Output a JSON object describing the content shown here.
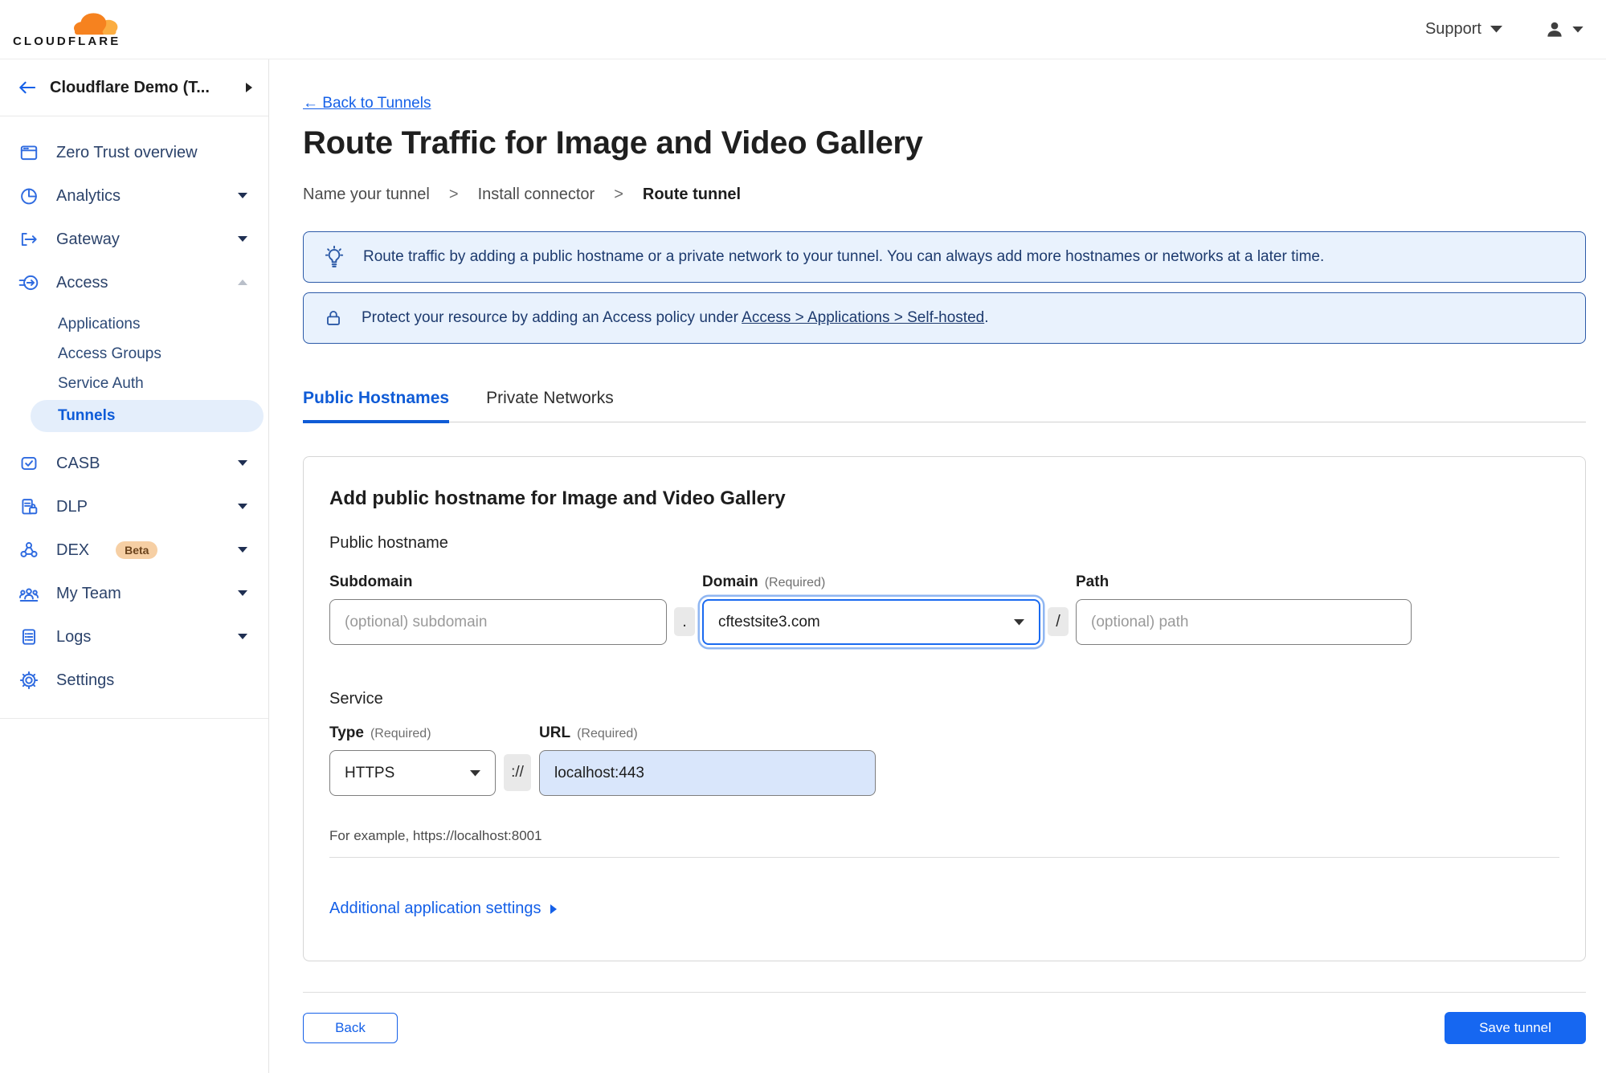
{
  "header": {
    "logo_text": "CLOUDFLARE",
    "support_label": "Support"
  },
  "sidebar": {
    "account": {
      "label": "Cloudflare Demo (T..."
    },
    "items": [
      {
        "label": "Zero Trust overview"
      },
      {
        "label": "Analytics"
      },
      {
        "label": "Gateway"
      },
      {
        "label": "Access"
      },
      {
        "label": "Applications"
      },
      {
        "label": "Access Groups"
      },
      {
        "label": "Service Auth"
      },
      {
        "label": "Tunnels"
      },
      {
        "label": "CASB"
      },
      {
        "label": "DLP"
      },
      {
        "label": "DEX",
        "badge": "Beta"
      },
      {
        "label": "My Team"
      },
      {
        "label": "Logs"
      },
      {
        "label": "Settings"
      }
    ]
  },
  "main": {
    "back_link": "← Back to Tunnels",
    "title": "Route Traffic for Image and Video Gallery",
    "steps": [
      "Name your tunnel",
      "Install connector",
      "Route tunnel"
    ],
    "steps_separator": ">",
    "banners": [
      {
        "text": "Route traffic by adding a public hostname or a private network to your tunnel. You can always add more hostnames or networks at a later time."
      },
      {
        "text_prefix": "Protect your resource by adding an Access policy under ",
        "link_text": "Access > Applications > Self-hosted",
        "text_suffix": "."
      }
    ],
    "tabs": [
      {
        "label": "Public Hostnames"
      },
      {
        "label": "Private Networks"
      }
    ],
    "form": {
      "heading": "Add public hostname for Image and Video Gallery",
      "public_hostname_label": "Public hostname",
      "subdomain_label": "Subdomain",
      "domain_label": "Domain",
      "path_label": "Path",
      "required_hint": "(Required)",
      "subdomain_placeholder": "(optional) subdomain",
      "domain_value": "cftestsite3.com",
      "path_placeholder": "(optional) path",
      "separators": {
        "dot": ".",
        "slash": "/",
        "scheme": "://"
      },
      "service_label": "Service",
      "type_label": "Type",
      "url_label": "URL",
      "type_value": "HTTPS",
      "url_value": "localhost:443",
      "example_text": "For example, https://localhost:8001",
      "additional_settings_label": "Additional application settings"
    },
    "footer": {
      "back_label": "Back",
      "save_label": "Save tunnel"
    }
  },
  "colors": {
    "primary_blue": "#1667f1",
    "link_blue": "#1560e8",
    "banner_border": "#2c5aa8",
    "banner_bg": "#e9f2fd",
    "brand_orange": "#F6821F",
    "brand_orange_light": "#FBAD41",
    "beta_badge_bg": "#f6cfa4"
  }
}
